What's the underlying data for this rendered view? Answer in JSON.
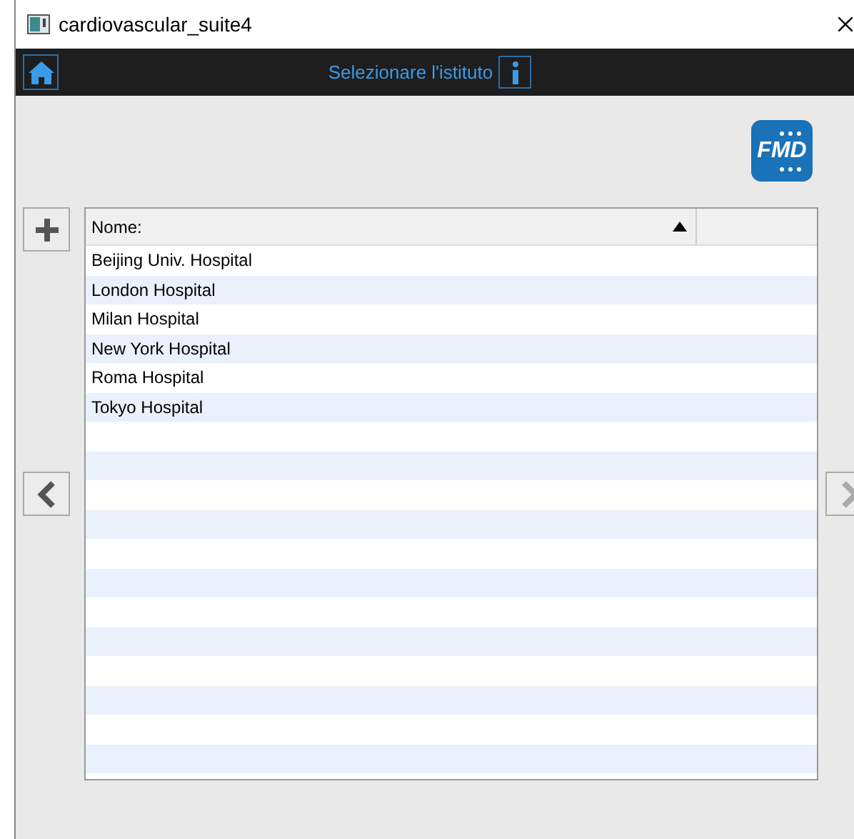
{
  "window": {
    "title": "cardiovascular_suite4"
  },
  "header": {
    "title": "Selezionare l'istituto"
  },
  "logo": {
    "text": "FMD"
  },
  "table": {
    "columns": [
      {
        "label": "Nome:",
        "sorted_ascending": true
      }
    ],
    "rows": [
      {
        "name": "Beijing Univ. Hospital"
      },
      {
        "name": "London Hospital"
      },
      {
        "name": "Milan Hospital"
      },
      {
        "name": "New York Hospital"
      },
      {
        "name": "Roma Hospital"
      },
      {
        "name": "Tokyo Hospital"
      }
    ]
  },
  "nav": {
    "prev_disabled": false,
    "next_disabled": true
  }
}
